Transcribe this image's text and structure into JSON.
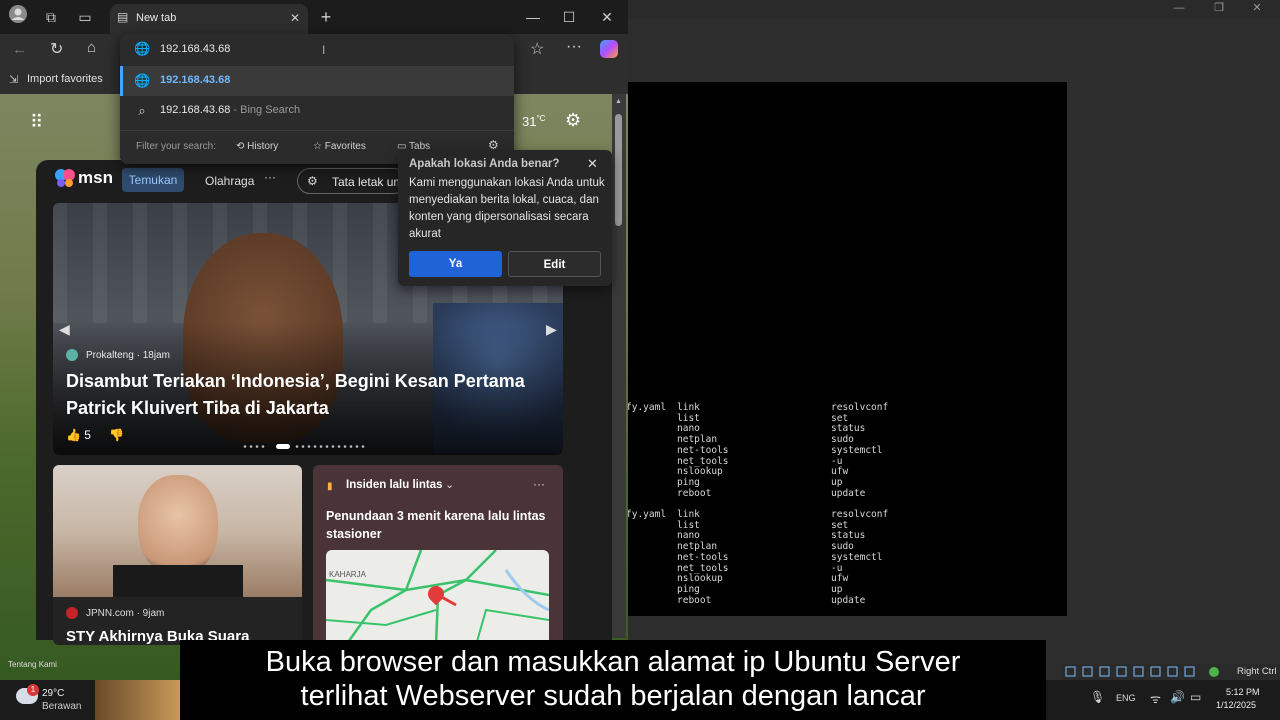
{
  "browser": {
    "tab_title": "New tab",
    "address_value": "192.168.43.68",
    "fav_import_label": "Import favorites",
    "dropdown": {
      "suggestion_url": "192.168.43.68",
      "search_query": "192.168.43.68",
      "search_suffix": "- Bing Search",
      "filter_label": "Filter your search:",
      "filters": [
        "History",
        "Favorites",
        "Tabs"
      ]
    }
  },
  "newtab": {
    "weather_temp": "31",
    "weather_unit": "°C",
    "msn_logo": "msn",
    "nav_items": [
      "Temukan",
      "Olahraga"
    ],
    "layout_button": "Tata letak um",
    "hero": {
      "source": "Prokalteng",
      "time": "· 18jam",
      "headline": "Disambut Teriakan ‘Indonesia’, Begini Kesan Pertama Patrick Kluivert Tiba di Jakarta",
      "likes": "5"
    },
    "card1": {
      "source": "JPNN.com",
      "time": "· 9jam",
      "headline": "STY Akhirnya Buka Suara Sentil Erick Tho... Timpas, Bikin T..."
    },
    "card2": {
      "label": "Insiden lalu lintas",
      "headline": "Penundaan 3 menit karena lalu lintas stasioner",
      "map_label": "KAHARJA"
    },
    "footer_text": "Tentang Kami"
  },
  "location_popup": {
    "title": "Apakah lokasi Anda benar?",
    "body": "Kami menggunakan lokasi Anda untuk menyediakan berita lokal, cuaca, dan konten yang dipersonalisasi secara akurat",
    "yes_label": "Ya",
    "edit_label": "Edit"
  },
  "terminal": {
    "blocks": [
      {
        "col1": [
          "fy.yaml",
          "",
          "",
          "",
          "",
          "",
          "",
          "",
          ""
        ],
        "col2": [
          "link",
          "list",
          "nano",
          "netplan",
          "net-tools",
          "net_tools",
          "nslookup",
          "ping",
          "reboot"
        ],
        "col3": [
          "resolvconf",
          "set",
          "status",
          "sudo",
          "systemctl",
          "-u",
          "ufw",
          "up",
          "update"
        ]
      },
      {
        "col1": [
          "fy.yaml",
          "",
          "",
          "",
          "",
          "",
          "",
          "",
          ""
        ],
        "col2": [
          "link",
          "list",
          "nano",
          "netplan",
          "net-tools",
          "net_tools",
          "nslookup",
          "ping",
          "reboot"
        ],
        "col3": [
          "resolvconf",
          "set",
          "status",
          "sudo",
          "systemctl",
          "-u",
          "ufw",
          "up",
          "update"
        ]
      }
    ]
  },
  "taskbar": {
    "weather_temp": "29°C",
    "weather_desc": "Berawan",
    "notif_count": "1",
    "lang": "ENG",
    "time": "5:12 PM",
    "date": "1/12/2025",
    "vm_hint": "Right Ctrl"
  },
  "caption": {
    "line1": "Buka browser dan masukkan alamat ip Ubuntu Server",
    "line2": "terlihat Webserver sudah berjalan dengan lancar"
  }
}
